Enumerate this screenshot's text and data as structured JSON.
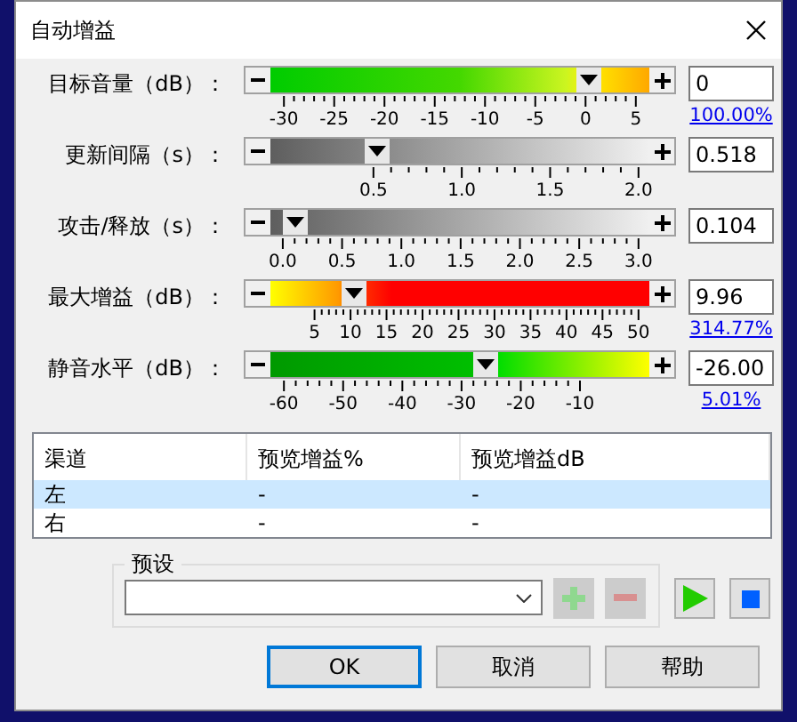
{
  "window": {
    "title": "自动增益"
  },
  "controls": [
    {
      "label": "目标音量（dB）：",
      "kind": "target",
      "level": 0.84,
      "value": "0",
      "ticks": [
        "-30",
        "-25",
        "-20",
        "-15",
        "-10",
        "-5",
        "0",
        "5"
      ],
      "percent": "100.00%"
    },
    {
      "label": "更新间隔（s）：",
      "kind": "interval",
      "level": 0.28,
      "value": "0.518",
      "ticks": [
        "0.5",
        "1.0",
        "1.5",
        "2.0"
      ]
    },
    {
      "label": "攻击/释放（s）：",
      "kind": "attack",
      "level": 0.065,
      "value": "0.104",
      "ticks": [
        "0.0",
        "0.5",
        "1.0",
        "1.5",
        "2.0",
        "2.5",
        "3.0"
      ]
    },
    {
      "label": "最大增益（dB）：",
      "kind": "max",
      "level": 0.22,
      "value": "9.96",
      "ticks": [
        "5",
        "10",
        "15",
        "20",
        "25",
        "30",
        "35",
        "40",
        "45",
        "50"
      ],
      "percent": "314.77%"
    },
    {
      "label": "静音水平（dB）：",
      "kind": "silence",
      "level": 0.57,
      "value": "-26.00",
      "ticks": [
        "-60",
        "-50",
        "-40",
        "-30",
        "-20",
        "-10"
      ],
      "percent": "5.01%"
    }
  ],
  "table": {
    "columns": [
      "渠道",
      "预览增益%",
      "预览增益dB"
    ],
    "rows": [
      {
        "cells": [
          "左",
          "-",
          "-"
        ],
        "selected": true
      },
      {
        "cells": [
          "右",
          "-",
          "-"
        ],
        "selected": false
      }
    ]
  },
  "presets": {
    "label": "预设",
    "add_disabled": true,
    "remove_disabled": true
  },
  "buttons": [
    {
      "label": "OK",
      "default": true
    },
    {
      "label": "取消",
      "default": false
    },
    {
      "label": "帮助",
      "default": false
    }
  ]
}
